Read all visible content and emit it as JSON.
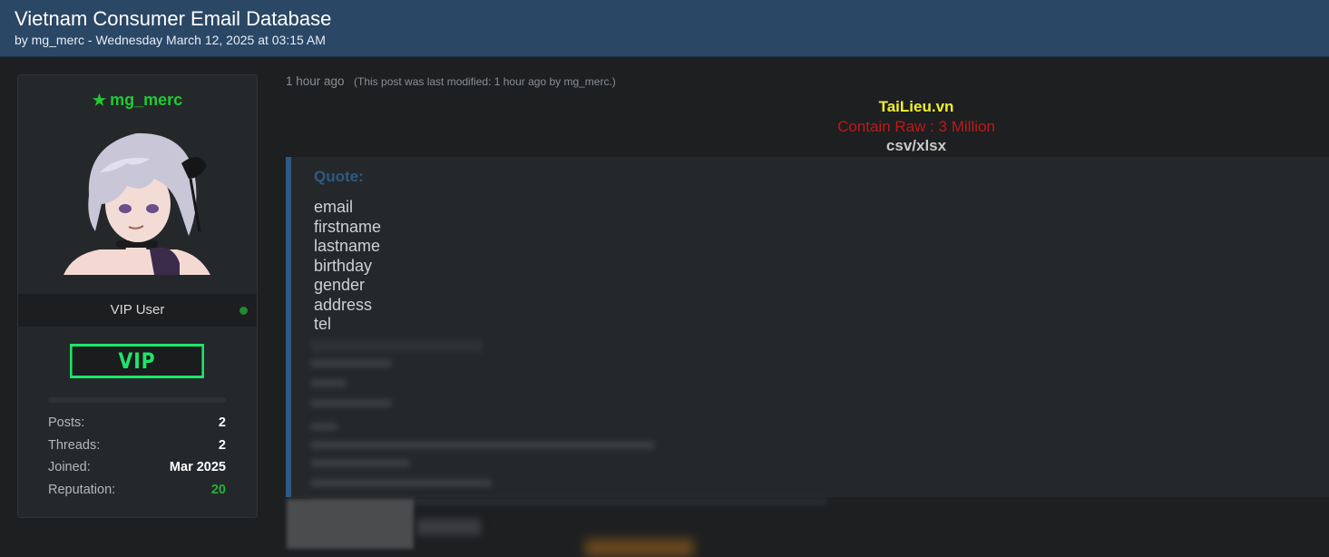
{
  "thread": {
    "title": "Vietnam Consumer Email Database",
    "byline": "by mg_merc - Wednesday March 12, 2025 at 03:15 AM"
  },
  "author": {
    "username": "mg_merc",
    "rank": "VIP User",
    "badge": "VIP",
    "online": true,
    "stats": [
      {
        "label": "Posts:",
        "value": "2"
      },
      {
        "label": "Threads:",
        "value": "2"
      },
      {
        "label": "Joined:",
        "value": "Mar 2025"
      },
      {
        "label": "Reputation:",
        "value": "20"
      }
    ]
  },
  "post": {
    "time": "1 hour ago",
    "modified": "(This post was last modified: 1 hour ago by mg_merc.)",
    "line1": "TaiLieu.vn",
    "line2": "Contain Raw : 3 Million",
    "line3": "csv/xlsx",
    "quote_label": "Quote:",
    "fields": [
      "email",
      "firstname",
      "lastname",
      "birthday",
      "gender",
      "address",
      "tel"
    ]
  },
  "colors": {
    "header_bg": "#2a4766",
    "username": "#22c932",
    "vip_badge": "#1ee66a",
    "quote_accent": "#2e5a85",
    "line1": "#f2ef2a",
    "line2": "#c01818"
  }
}
